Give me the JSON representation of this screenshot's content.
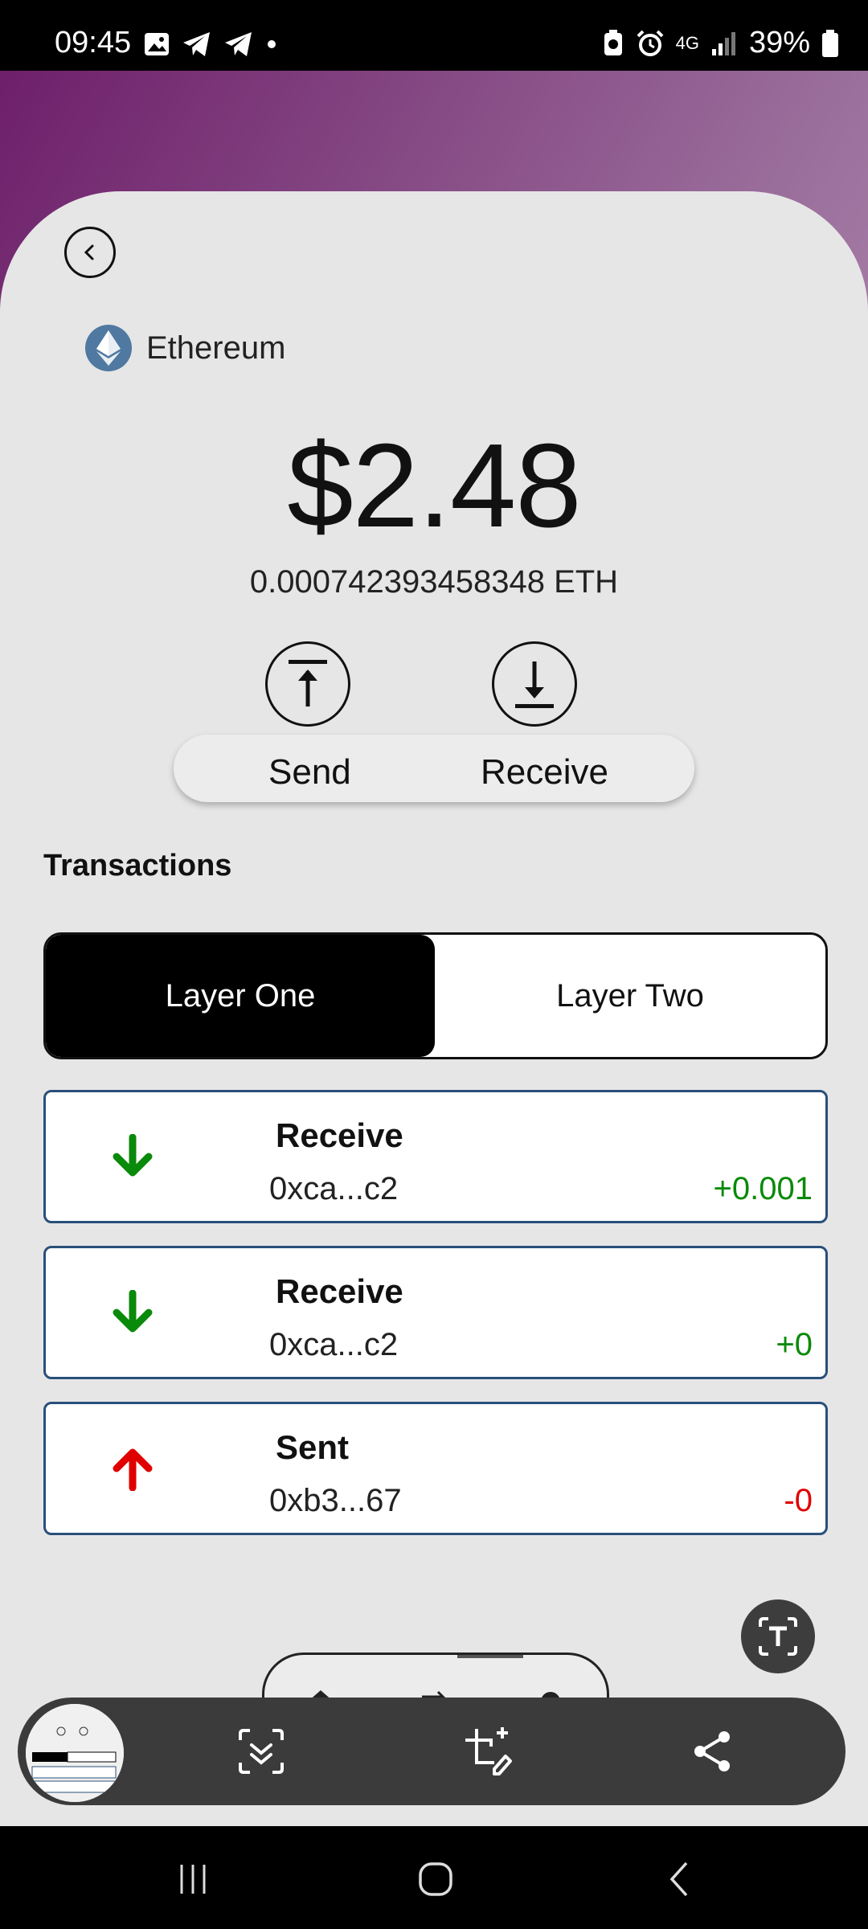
{
  "status_bar": {
    "time": "09:45",
    "network": "4G",
    "battery": "39%"
  },
  "asset": {
    "name": "Ethereum",
    "balance_usd": "$2.48",
    "balance_eth": "0.000742393458348 ETH"
  },
  "actions": {
    "send_label": "Send",
    "receive_label": "Receive"
  },
  "transactions": {
    "title": "Transactions",
    "tabs": [
      {
        "label": "Layer One",
        "active": true
      },
      {
        "label": "Layer Two",
        "active": false
      }
    ],
    "items": [
      {
        "type": "Receive",
        "address": "0xca...c2",
        "amount": "+0.001",
        "direction": "in"
      },
      {
        "type": "Receive",
        "address": "0xca...c2",
        "amount": "+0",
        "direction": "in"
      },
      {
        "type": "Sent",
        "address": "0xb3...67",
        "amount": "-0",
        "direction": "out"
      }
    ]
  },
  "colors": {
    "positive": "#0a8a0a",
    "negative": "#e00000",
    "accent_border": "#2a4f7a",
    "eth_logo": "#4f79a0"
  },
  "icons": {
    "back": "chevron-left-icon",
    "send": "upload-icon",
    "receive": "download-icon",
    "text_extract": "text-extract-icon",
    "home": "home-icon",
    "swap": "swap-icon",
    "settings": "gear-icon",
    "scroll_capture": "scroll-capture-icon",
    "edit": "crop-edit-icon",
    "share": "share-icon"
  }
}
